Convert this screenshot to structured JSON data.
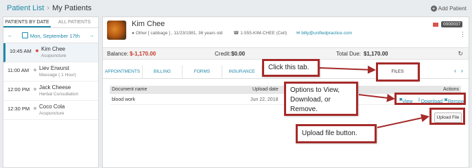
{
  "header": {
    "breadcrumb_root": "Patient List",
    "breadcrumb_sep": "›",
    "breadcrumb_current": "My Patients",
    "add_patient": "Add Patient"
  },
  "left": {
    "tabs": [
      "PATIENTS BY DATE",
      "ALL PATIENTS"
    ],
    "date": "Mon, September 17th",
    "appointments": [
      {
        "time": "10:45 AM",
        "name": "Kim Chee",
        "service": "Acupuncture"
      },
      {
        "time": "11:00 AM",
        "name": "Liev Erwurst",
        "service": "Massage ( 1 Hour)"
      },
      {
        "time": "12:00 PM",
        "name": "Jack Cheese",
        "service": "Herbal Consultation"
      },
      {
        "time": "12:30 PM",
        "name": "Coco Cola",
        "service": "Acupuncture"
      }
    ]
  },
  "patient": {
    "name": "Kim Chee",
    "info": "Other [ cabbage ] , 11/23/1981, 36 years old",
    "phone": "1-555-KIM-CHEE (Cell)",
    "email": "billy@unifiedpractice.com",
    "id": "0000037"
  },
  "balance": {
    "balance_label": "Balance:",
    "balance_value": "$-1,170.00",
    "credit_label": "Credit:",
    "credit_value": "$0.00",
    "total_label": "Total Due:",
    "total_value": "$1,170.00"
  },
  "nav_tabs": [
    "APPOINTMENTS",
    "BILLING",
    "FORMS",
    "INSURANCE",
    "FILES"
  ],
  "files_table": {
    "headers": [
      "Document name",
      "Upload date",
      "Actions"
    ],
    "rows": [
      {
        "name": "blood work",
        "date": "Jun 22, 2018",
        "view": "View",
        "download": "Download",
        "remove": "Remove"
      }
    ],
    "upload_button": "Upload File"
  },
  "callouts": {
    "tab": "Click this tab.",
    "options": "Options to View, Download, or Remove.",
    "upload": "Upload file button."
  },
  "colors": {
    "accent": "#1e88a8",
    "callout_border": "#a52a2a",
    "balance_negative": "#c0392b"
  }
}
